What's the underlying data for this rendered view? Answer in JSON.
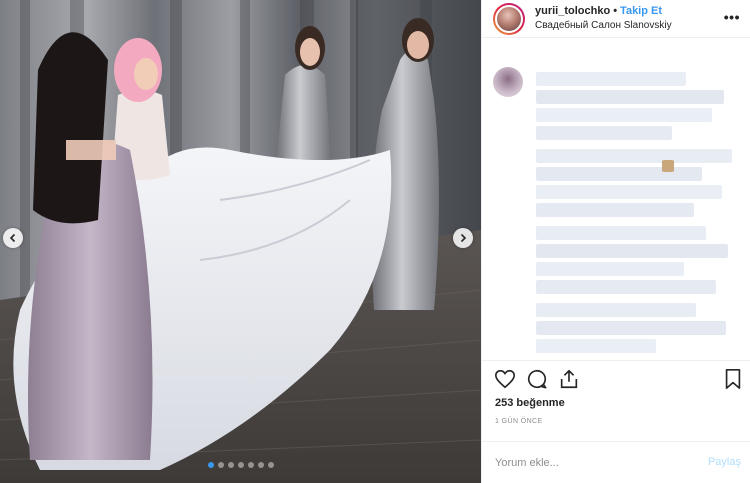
{
  "post": {
    "username": "yurii_tolochko",
    "separator": "•",
    "follow_label": "Takip Et",
    "location": "Свадебный Салон Slanovskiy",
    "more_icon": "more-options-icon"
  },
  "media": {
    "prev_icon": "chevron-left-icon",
    "next_icon": "chevron-right-icon",
    "dots_total": 7,
    "active_dot": 0
  },
  "engagement": {
    "likes_text": "253 beğenme",
    "time_text": "1 GÜN ÖNCE",
    "icons": [
      "heart-icon",
      "comment-icon",
      "share-icon",
      "bookmark-icon"
    ]
  },
  "comment": {
    "placeholder": "Yorum ekle...",
    "post_label": "Paylaş"
  },
  "colors": {
    "accent": "#3897f0",
    "disabled_post": "#b2dffc",
    "muted_text": "#8e8e8e",
    "border": "#efefef"
  }
}
